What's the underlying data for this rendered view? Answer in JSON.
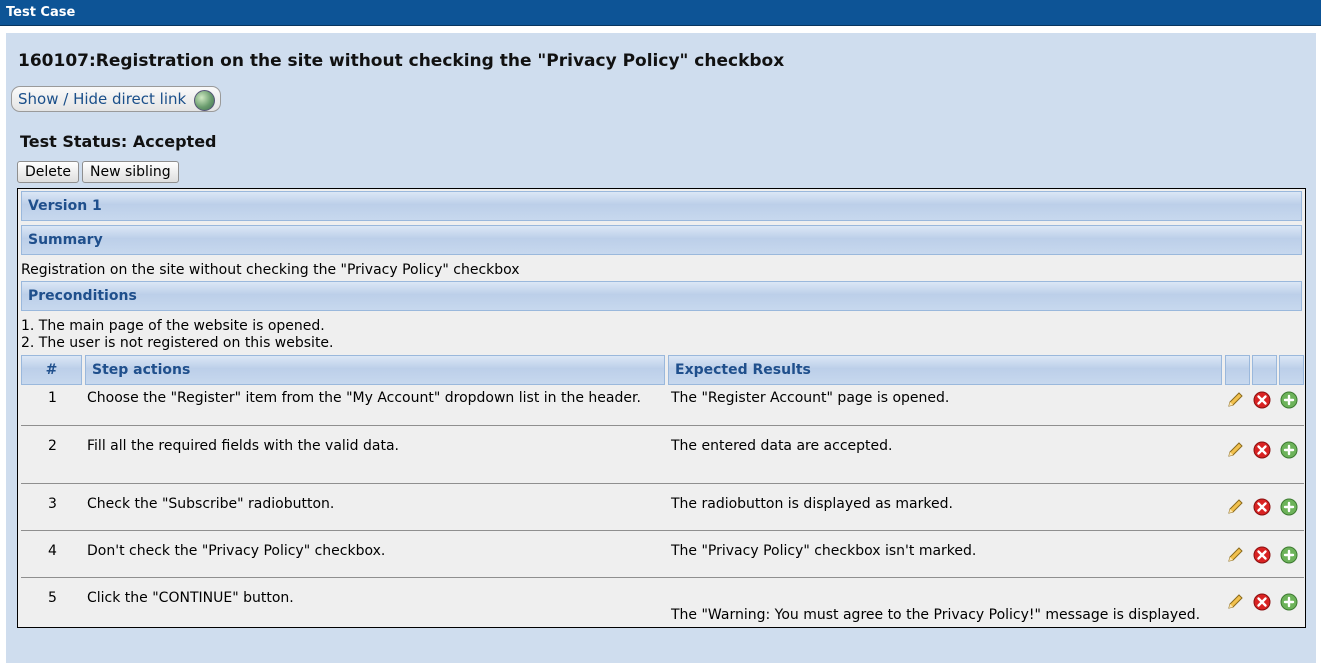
{
  "window": {
    "title": "Test Case"
  },
  "testcase": {
    "title": "160107:Registration on the site without checking the \"Privacy Policy\" checkbox",
    "direct_link_label": "Show / Hide direct link",
    "status": "Test Status: Accepted"
  },
  "buttons": {
    "delete": "Delete",
    "new_sibling": "New sibling"
  },
  "version": {
    "label": "Version 1"
  },
  "summary": {
    "header": "Summary",
    "text": "Registration on the site without checking the \"Privacy Policy\" checkbox"
  },
  "preconditions": {
    "header": "Preconditions",
    "lines": [
      "1. The main page of the website is opened.",
      "2. The user is not registered on this website."
    ]
  },
  "steps": {
    "columns": {
      "num": "#",
      "actions": "Step actions",
      "expected": "Expected Results"
    },
    "rows": [
      {
        "num": "1",
        "action": "Choose the \"Register\" item from the \"My Account\" dropdown list in the header.",
        "expected": "The \"Register Account\" page is opened."
      },
      {
        "num": "2",
        "action": "Fill all the required fields with the valid data.",
        "expected": "The entered data are accepted."
      },
      {
        "num": "3",
        "action": "Check the \"Subscribe\" radiobutton.",
        "expected": "The radiobutton is displayed as marked."
      },
      {
        "num": "4",
        "action": "Don't check the \"Privacy Policy\" checkbox.",
        "expected": "The \"Privacy Policy\" checkbox isn't marked."
      },
      {
        "num": "5",
        "action": "Click the \"CONTINUE\" button.",
        "expected": "The \"Warning: You must agree to the Privacy Policy!\" message is displayed."
      }
    ]
  },
  "icons": {
    "direct_link": "globe-icon",
    "row_edit": "pencil-icon",
    "row_delete": "delete-icon",
    "row_add": "add-icon"
  },
  "colors": {
    "title_bar": "#0d5496",
    "workarea": "#cfddee",
    "section_header_text": "#1f4f8c"
  }
}
